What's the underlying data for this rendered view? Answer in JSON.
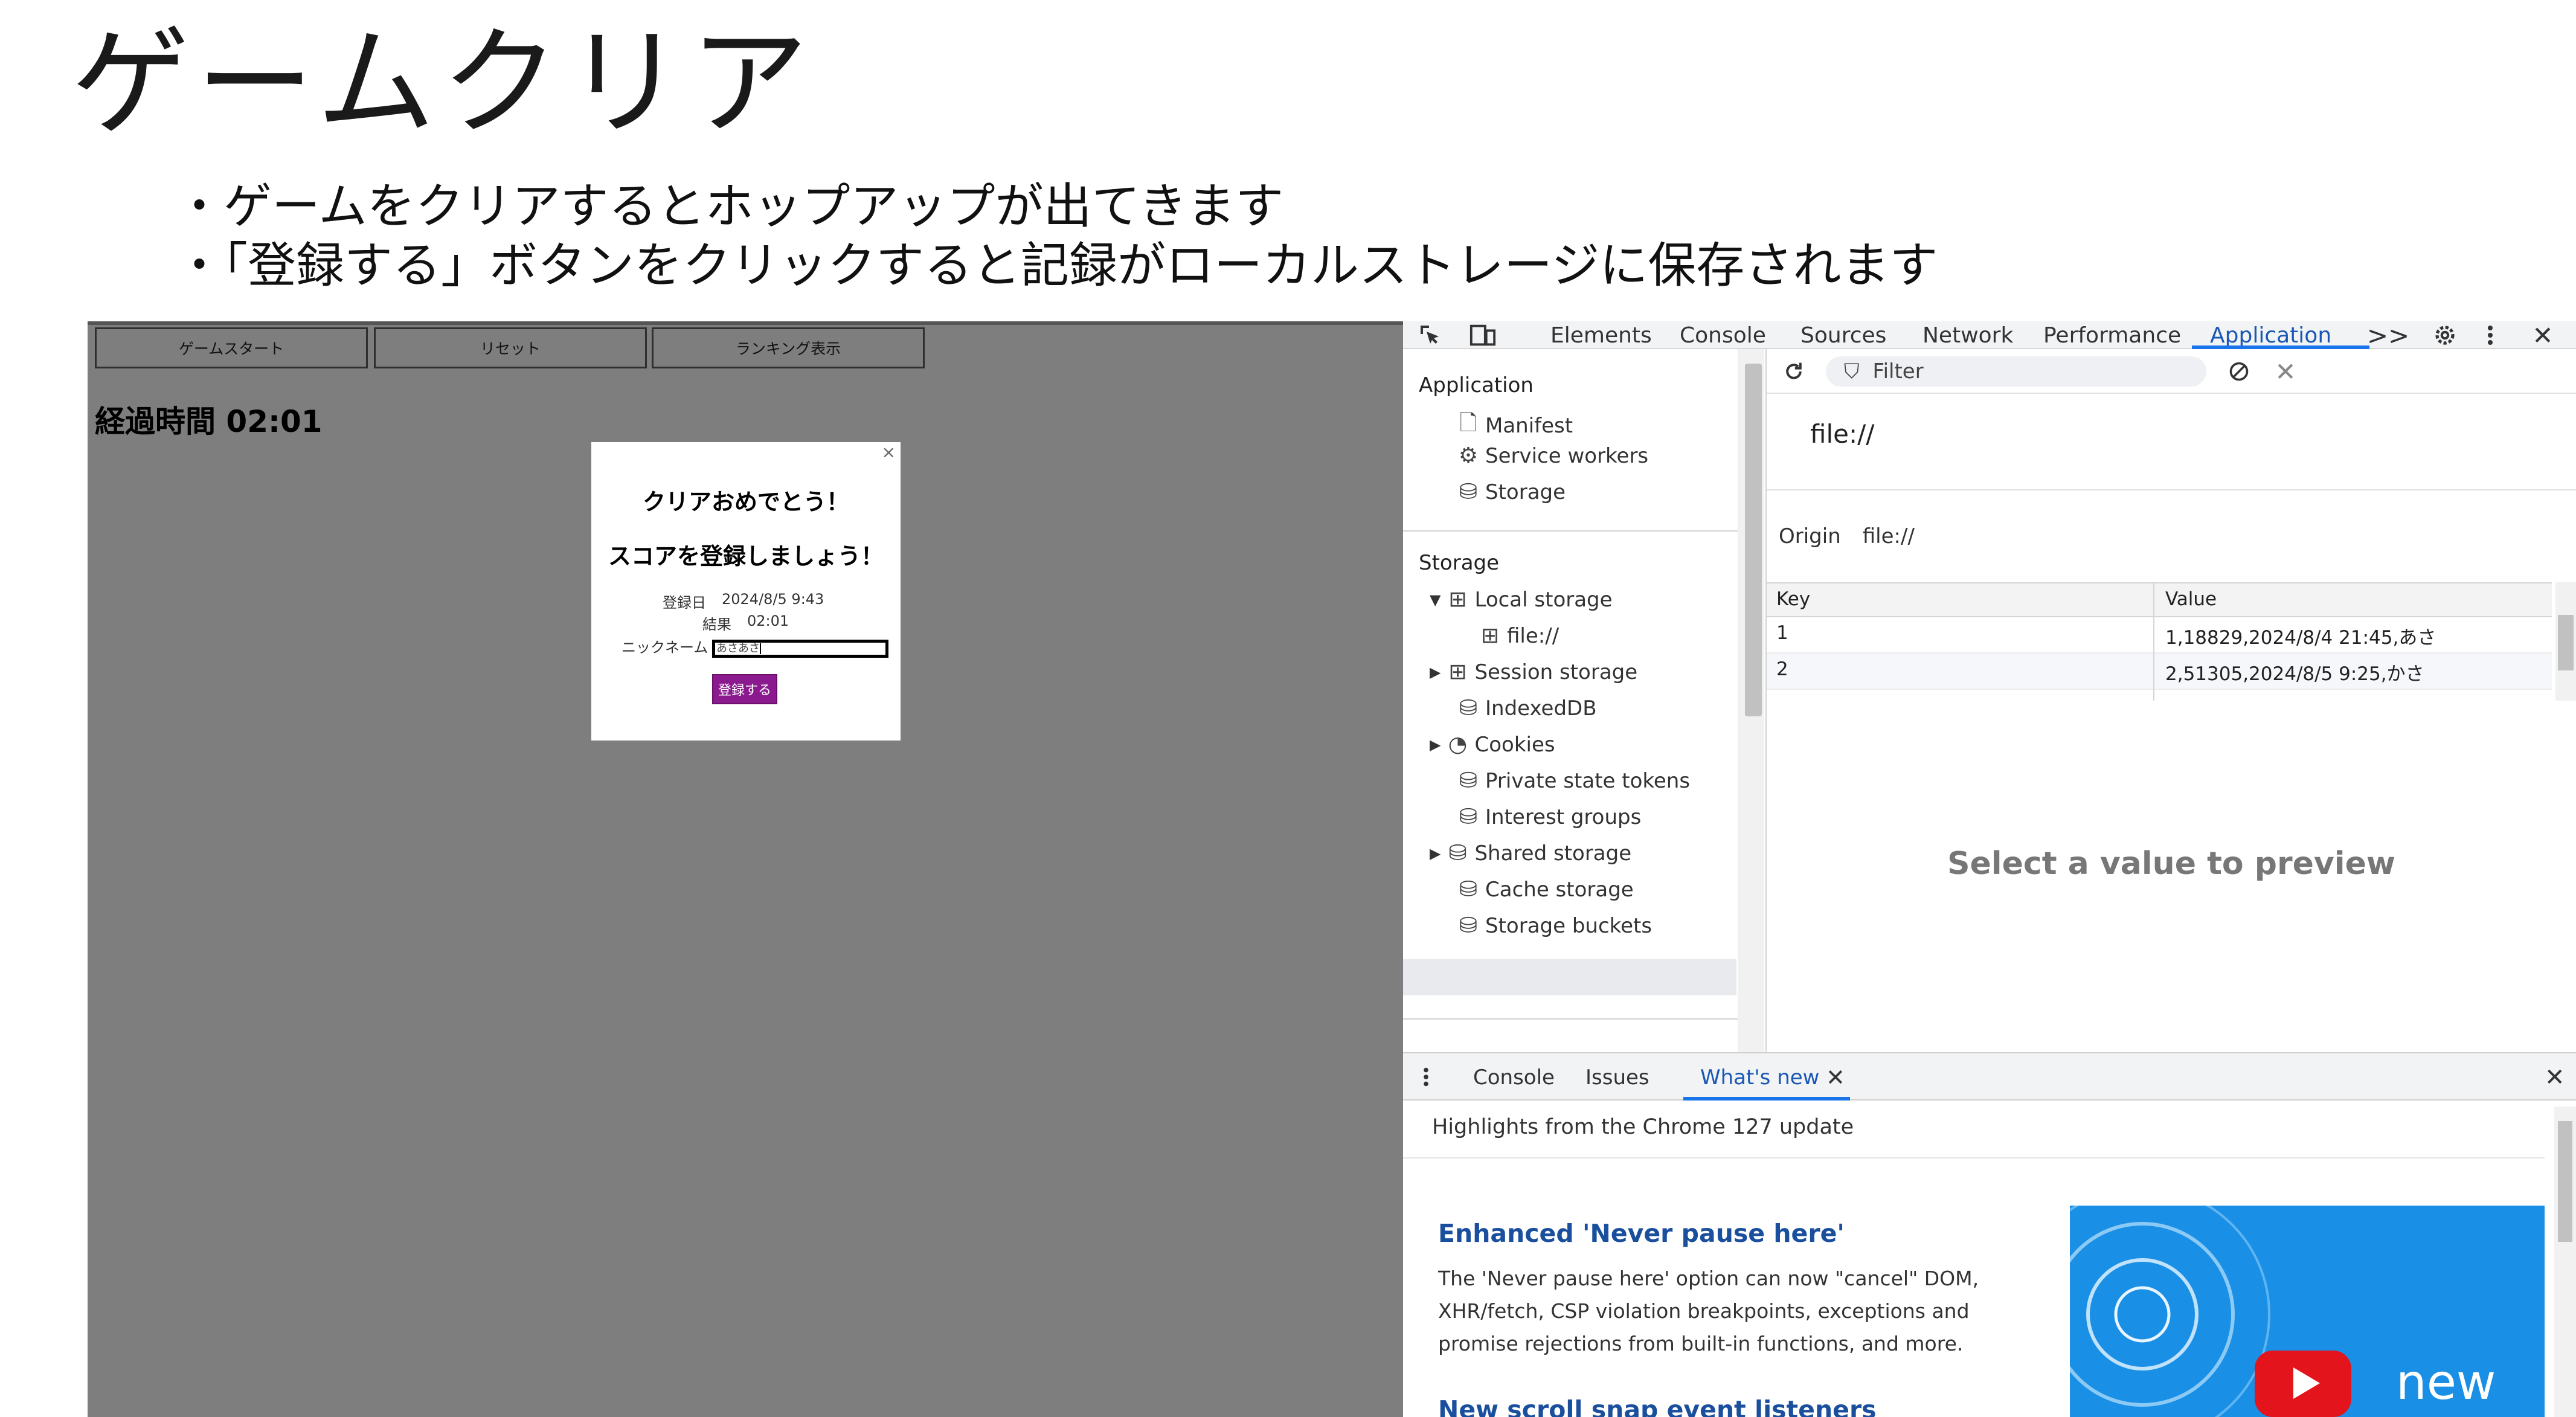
{
  "slide": {
    "title": "ゲームクリア",
    "bullets": [
      "・ゲームをクリアするとホップアップが出てきます",
      "・「登録する」ボタンをクリックすると記録がローカルストレージに保存されます"
    ]
  },
  "game": {
    "buttons": [
      "ゲームスタート",
      "リセット",
      "ランキング表示"
    ],
    "elapsed": "経過時間 02:01",
    "popup": {
      "close": "×",
      "heading1": "クリアおめでとう！",
      "heading2": "スコアを登録しましょう！",
      "date_label": "登録日",
      "date_value": "2024/8/5 9:43",
      "result_label": "結果",
      "result_value": "02:01",
      "nickname_label": "ニックネーム",
      "nickname_value": "あさあさ",
      "submit_label": "登録する"
    }
  },
  "devtools": {
    "tabs": [
      "Elements",
      "Console",
      "Sources",
      "Network",
      "Performance",
      "Application"
    ],
    "active_tab": "Application",
    "more": ">>",
    "close": "✕",
    "sidebar": {
      "application_header": "Application",
      "application_items": [
        "Manifest",
        "Service workers",
        "Storage"
      ],
      "storage_header": "Storage",
      "storage_items": {
        "local_storage": "Local storage",
        "local_storage_child": "file://",
        "session_storage": "Session storage",
        "indexeddb": "IndexedDB",
        "cookies": "Cookies",
        "private_state_tokens": "Private state tokens",
        "interest_groups": "Interest groups",
        "shared_storage": "Shared storage",
        "cache_storage": "Cache storage",
        "storage_buckets": "Storage buckets"
      }
    },
    "main": {
      "filter_placeholder": "Filter",
      "origin_heading": "file://",
      "origin_label": "Origin",
      "origin_value": "file://",
      "table": {
        "columns": [
          "Key",
          "Value"
        ],
        "rows": [
          [
            "1",
            "1,18829,2024/8/4 21:45,あさ"
          ],
          [
            "2",
            "2,51305,2024/8/5 9:25,かさ"
          ]
        ]
      },
      "preview_message": "Select a value to preview"
    },
    "drawer": {
      "tabs": [
        "Console",
        "Issues",
        "What's new"
      ],
      "active_tab": "What's new",
      "highlights": "Highlights from the Chrome 127 update",
      "news": [
        {
          "title": "Enhanced 'Never pause here'",
          "body": "The 'Never pause here' option can now \"cancel\" DOM, XHR/fetch, CSP violation breakpoints, exceptions and promise rejections from built-in functions, and more."
        },
        {
          "title": "New scroll snap event listeners"
        }
      ],
      "image_text": "new"
    },
    "colors": {
      "accent": "#1a73e8",
      "game_bg": "#7e7e7e",
      "submit": "#8b1a8e"
    }
  }
}
